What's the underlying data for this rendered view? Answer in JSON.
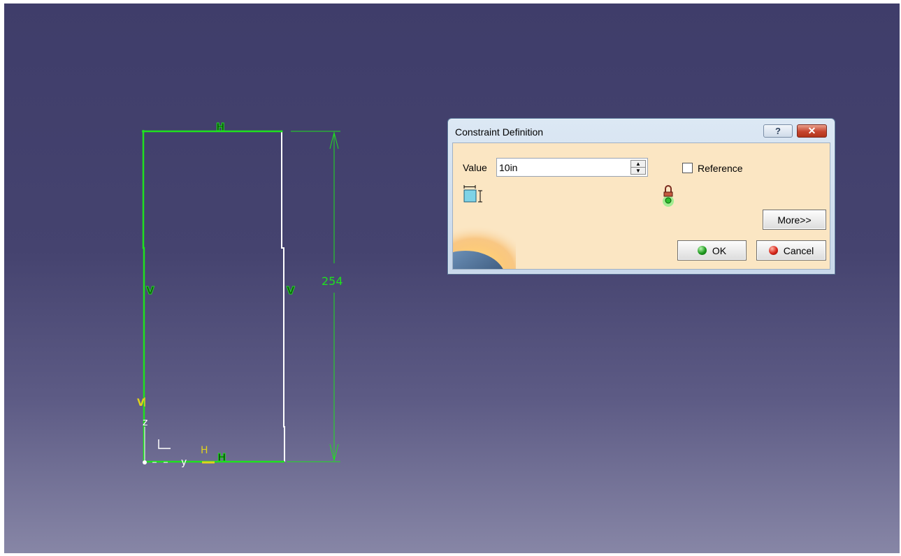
{
  "sketch": {
    "top_constraint": "H",
    "left_constraint": "V",
    "right_constraint": "V",
    "bottom_constraint": "H",
    "dimension_value": "254",
    "axis_v_label": "V",
    "axis_h_label": "H",
    "axis_z_label": "z",
    "axis_y_label": "y"
  },
  "dialog": {
    "title": "Constraint Definition",
    "help_label": "?",
    "close_label": "✕",
    "value_label": "Value",
    "value": "10in",
    "reference_label": "Reference",
    "reference_checked": false,
    "more_label": "More>>",
    "ok_label": "OK",
    "cancel_label": "Cancel"
  },
  "icons": [
    "dimension-constraint-icon",
    "lock-icon",
    "help-icon",
    "close-icon",
    "spin-up-icon",
    "spin-down-icon",
    "ok-status-icon",
    "cancel-status-icon",
    "earth-logo-icon"
  ],
  "colors": {
    "viewport_top": "#3f3d6a",
    "viewport_bottom": "#8786a6",
    "constrained_geometry": "#1fe01f",
    "unconstrained_geometry": "#ffffff",
    "axis_highlight": "#e0d21c",
    "dialog_body": "#fbe6c3"
  }
}
